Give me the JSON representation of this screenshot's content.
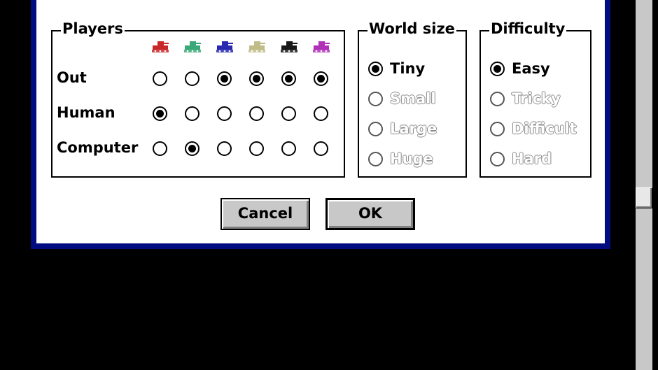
{
  "players": {
    "title": "Players",
    "tank_colors": [
      "#c8282a",
      "#3aa878",
      "#2828b0",
      "#c0bc88",
      "#181818",
      "#b030b8"
    ],
    "rows": [
      {
        "label": "Out",
        "selected": [
          false,
          false,
          true,
          true,
          true,
          true
        ]
      },
      {
        "label": "Human",
        "selected": [
          true,
          false,
          false,
          false,
          false,
          false
        ]
      },
      {
        "label": "Computer",
        "selected": [
          false,
          true,
          false,
          false,
          false,
          false
        ]
      }
    ]
  },
  "world_size": {
    "title": "World size",
    "options": [
      {
        "label": "Tiny",
        "checked": true,
        "enabled": true
      },
      {
        "label": "Small",
        "checked": false,
        "enabled": false
      },
      {
        "label": "Large",
        "checked": false,
        "enabled": false
      },
      {
        "label": "Huge",
        "checked": false,
        "enabled": false
      }
    ]
  },
  "difficulty": {
    "title": "Difficulty",
    "options": [
      {
        "label": "Easy",
        "checked": true,
        "enabled": true
      },
      {
        "label": "Tricky",
        "checked": false,
        "enabled": false
      },
      {
        "label": "Difficult",
        "checked": false,
        "enabled": false
      },
      {
        "label": "Hard",
        "checked": false,
        "enabled": false
      }
    ]
  },
  "buttons": {
    "cancel": "Cancel",
    "ok": "OK"
  }
}
